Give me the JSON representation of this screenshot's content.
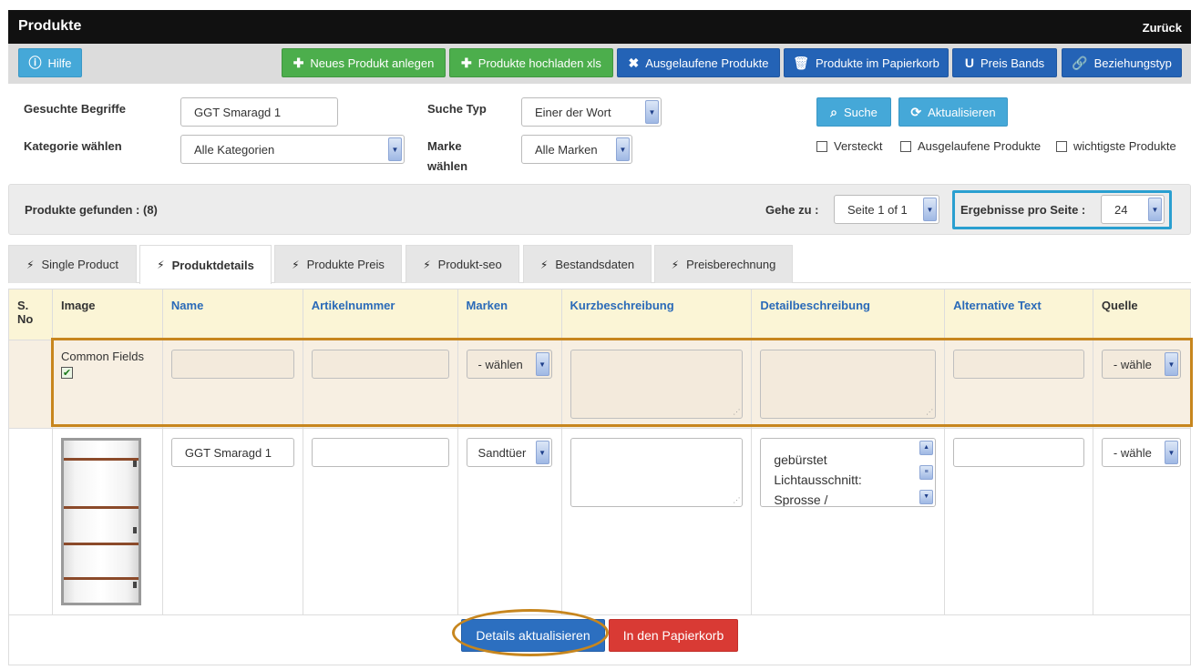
{
  "header": {
    "title": "Produkte",
    "back": "Zurück"
  },
  "toolbar": {
    "help": "Hilfe",
    "new_product": "Neues Produkt anlegen",
    "upload_xls": "Produkte hochladen xls",
    "expired": "Ausgelaufene Produkte",
    "trash": "Produkte im Papierkorb",
    "price_bands": "Preis Bands",
    "relation_type": "Beziehungstyp"
  },
  "search": {
    "terms_label": "Gesuchte Begriffe",
    "terms_value": "GGT Smaragd 1",
    "category_label": "Kategorie wählen",
    "category_value": "Alle Kategorien",
    "type_label": "Suche Typ",
    "type_value": "Einer der Wort",
    "brand_label_1": "Marke",
    "brand_label_2": "wählen",
    "brand_value": "Alle Marken",
    "search_button": "Suche",
    "refresh_button": "Aktualisieren",
    "hidden": "Versteckt",
    "expired_products": "Ausgelaufene Produkte",
    "important_products": "wichtigste Produkte"
  },
  "results": {
    "found": "Produkte gefunden : (8)",
    "goto_label": "Gehe zu :",
    "goto_value": "Seite 1 of 1",
    "per_page_label": "Ergebnisse pro Seite :",
    "per_page_value": "24"
  },
  "tabs": [
    "Single Product",
    "Produktdetails",
    "Produkte Preis",
    "Produkt-seo",
    "Bestandsdaten",
    "Preisberechnung"
  ],
  "active_tab": "Produktdetails",
  "columns": {
    "sno_1": "S.",
    "sno_2": "No",
    "image": "Image",
    "name": "Name",
    "article": "Artikelnummer",
    "brands": "Marken",
    "short_desc": "Kurzbeschreibung",
    "long_desc": "Detailbeschreibung",
    "alt_text": "Alternative Text",
    "source": "Quelle"
  },
  "common_row": {
    "label": "Common Fields",
    "brand_select": "- wählen",
    "source_select": "- wähle"
  },
  "product_row": {
    "name": "GGT Smaragd 1",
    "brand": "Sandtüer",
    "detail_lines": [
      "gebürstet",
      "Lichtausschnitt:",
      "Sprosse /"
    ],
    "source_select": "- wähle"
  },
  "actions": {
    "update": "Details aktualisieren",
    "to_trash": "In den Papierkorb"
  },
  "colors": {
    "header_bg": "#111111",
    "info": "#45a8d8",
    "green": "#4cae4c",
    "blue": "#2463b6",
    "red": "#d93a34",
    "highlight_orange": "#c7861e",
    "highlight_cyan": "#2a9fd0"
  }
}
